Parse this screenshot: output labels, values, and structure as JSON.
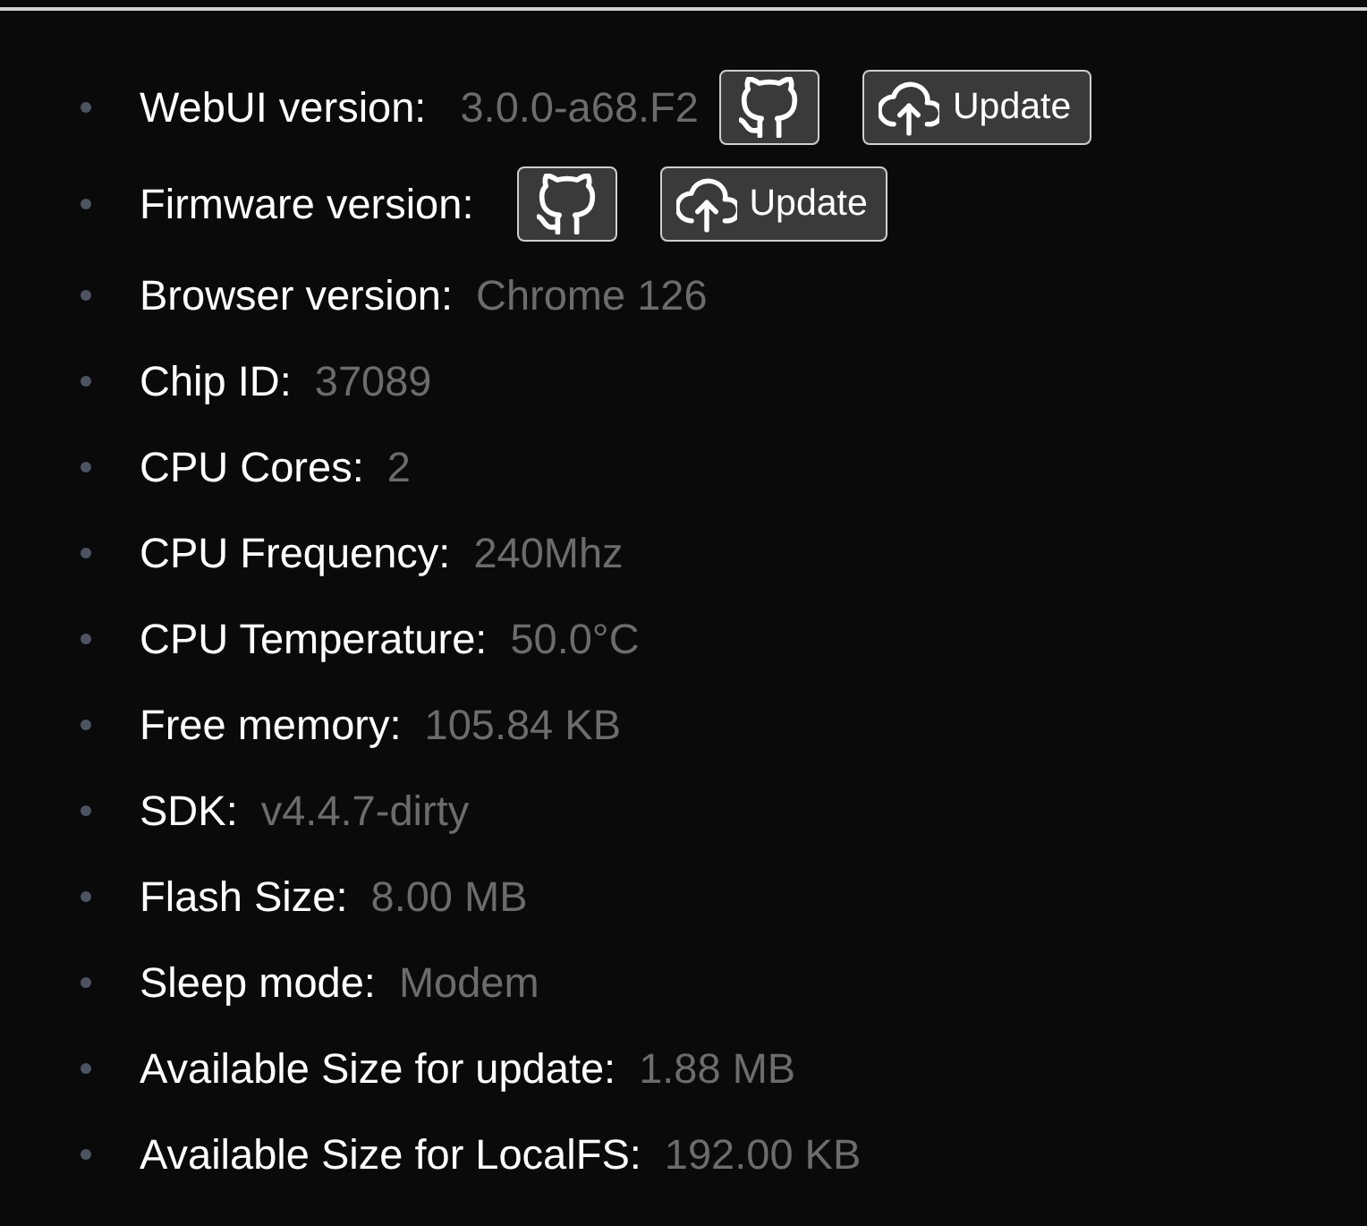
{
  "items": [
    {
      "label": "WebUI version:",
      "value": "3.0.0-a68.F2",
      "buttons": [
        {
          "kind": "github"
        },
        {
          "kind": "update",
          "label": "Update"
        }
      ]
    },
    {
      "label": "Firmware version:",
      "buttons": [
        {
          "kind": "github"
        },
        {
          "kind": "update",
          "label": "Update"
        }
      ]
    },
    {
      "label": "Browser version:",
      "value": "Chrome 126"
    },
    {
      "label": "Chip ID:",
      "value": "37089"
    },
    {
      "label": "CPU Cores:",
      "value": "2"
    },
    {
      "label": "CPU Frequency:",
      "value": "240Mhz"
    },
    {
      "label": "CPU Temperature:",
      "value": "50.0°C"
    },
    {
      "label": "Free memory:",
      "value": "105.84 KB"
    },
    {
      "label": "SDK:",
      "value": "v4.4.7-dirty"
    },
    {
      "label": "Flash Size:",
      "value": "8.00 MB"
    },
    {
      "label": "Sleep mode:",
      "value": "Modem"
    },
    {
      "label": "Available Size for update:",
      "value": "1.88 MB"
    },
    {
      "label": "Available Size for LocalFS:",
      "value": "192.00 KB"
    }
  ]
}
